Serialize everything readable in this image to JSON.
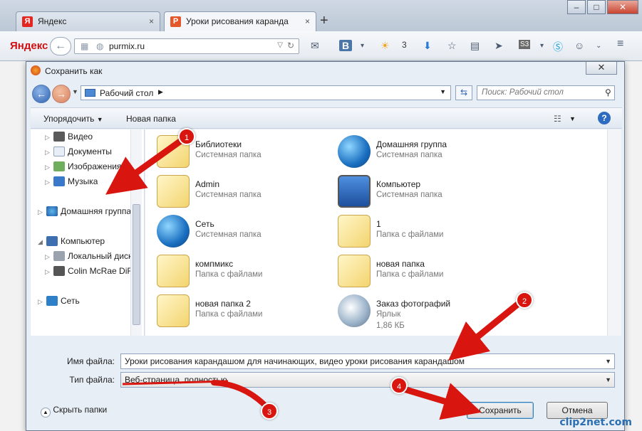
{
  "browser": {
    "tabs": [
      {
        "label": "Яндекс",
        "favicon": "Я",
        "favicon_color": "#e52620"
      },
      {
        "label": "Уроки рисования каранда",
        "favicon": "P",
        "favicon_color": "#e4572a"
      }
    ],
    "logo": "Яндекс",
    "url": "purmix.ru",
    "weather_count": "3",
    "new_tab_symbol": "+"
  },
  "dialog": {
    "title": "Сохранить как",
    "address": "Рабочий стол",
    "search_placeholder": "Поиск: Рабочий стол",
    "toolbar": {
      "organize": "Упорядочить",
      "new_folder": "Новая папка"
    },
    "nav_items": [
      {
        "label": "Видео",
        "icon": "video-icon"
      },
      {
        "label": "Документы",
        "icon": "documents-icon"
      },
      {
        "label": "Изображения",
        "icon": "images-icon"
      },
      {
        "label": "Музыка",
        "icon": "music-icon"
      },
      {
        "label": "Домашняя группа",
        "icon": "homegroup-icon"
      },
      {
        "label": "Компьютер",
        "icon": "computer-icon"
      },
      {
        "label": "Локальный диск",
        "icon": "drive-icon"
      },
      {
        "label": "Colin McRae DiR",
        "icon": "cd-drive-icon"
      },
      {
        "label": "Сеть",
        "icon": "network-icon"
      }
    ],
    "items": [
      {
        "name": "Библиотеки",
        "type": "Системная папка",
        "icon": "libraries-icon"
      },
      {
        "name": "Домашняя группа",
        "type": "Системная папка",
        "icon": "homegroup-icon"
      },
      {
        "name": "Admin",
        "type": "Системная папка",
        "icon": "user-folder-icon"
      },
      {
        "name": "Компьютер",
        "type": "Системная папка",
        "icon": "computer-icon"
      },
      {
        "name": "Сеть",
        "type": "Системная папка",
        "icon": "network-icon"
      },
      {
        "name": "1",
        "type": "Папка с файлами",
        "icon": "folder-icon"
      },
      {
        "name": "компмикс",
        "type": "Папка с файлами",
        "icon": "folder-icon"
      },
      {
        "name": "новая папка",
        "type": "Папка с файлами",
        "icon": "folder-icon"
      },
      {
        "name": "новая папка 2",
        "type": "Папка с файлами",
        "icon": "folder-icon"
      },
      {
        "name": "Заказ фотографий",
        "type": "Ярлык",
        "size": "1,86 КБ",
        "icon": "shortcut-icon"
      }
    ],
    "filename_label": "Имя файла:",
    "filename_value": "Уроки рисования карандашом для начинающих, видео уроки рисования карандашом",
    "filetype_label": "Тип файла:",
    "filetype_value": "Веб-страница, полностью",
    "hide_folders": "Скрыть папки",
    "save_button": "Сохранить",
    "cancel_button": "Отмена"
  },
  "annotations": {
    "markers": [
      "1",
      "2",
      "3",
      "4"
    ],
    "accent": "#d8160f"
  },
  "watermark": "clip2net.com"
}
